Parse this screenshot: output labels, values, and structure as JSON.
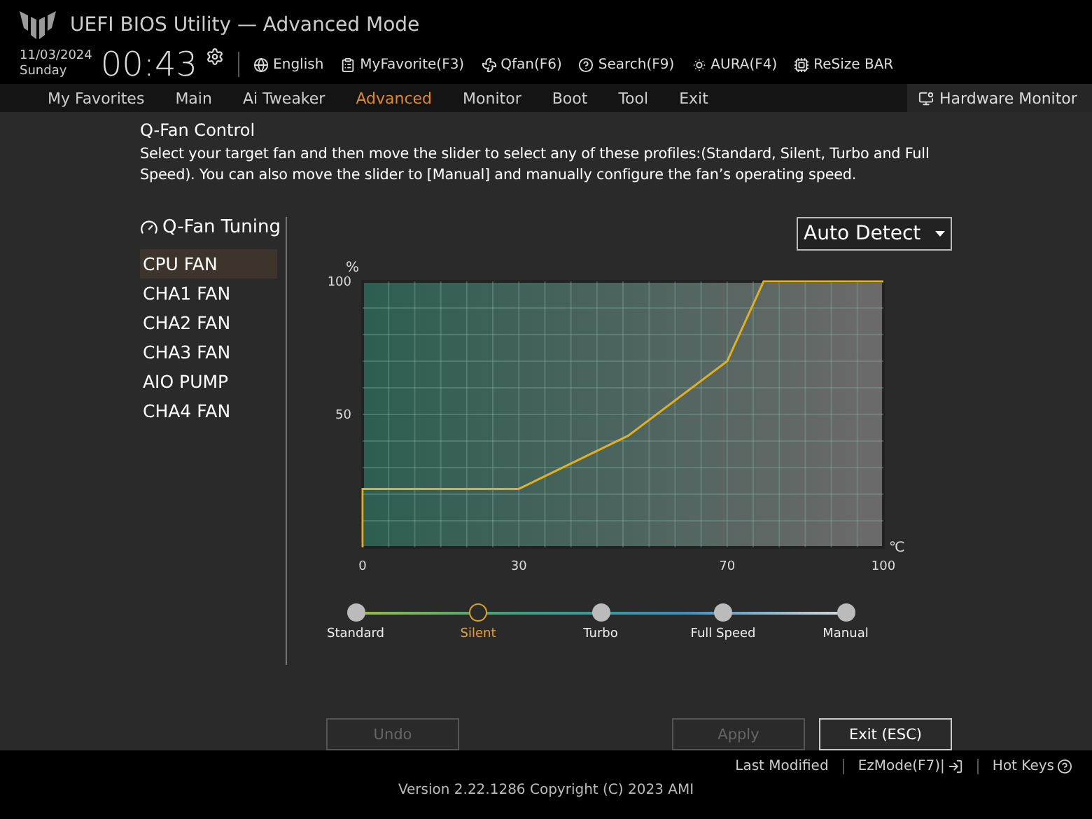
{
  "header": {
    "title": "UEFI BIOS Utility — Advanced Mode",
    "date": "11/03/2024",
    "day": "Sunday",
    "time": "00:43",
    "toolbar": [
      {
        "label": "English",
        "kind": "globe"
      },
      {
        "label": "MyFavorite(F3)",
        "kind": "list"
      },
      {
        "label": "Qfan(F6)",
        "kind": "fan"
      },
      {
        "label": "Search(F9)",
        "kind": "help"
      },
      {
        "label": "AURA(F4)",
        "kind": "light"
      },
      {
        "label": "ReSize BAR",
        "kind": "chip"
      }
    ]
  },
  "tabs": [
    {
      "label": "My Favorites",
      "selected": false
    },
    {
      "label": "Main",
      "selected": false
    },
    {
      "label": "Ai Tweaker",
      "selected": false
    },
    {
      "label": "Advanced",
      "selected": true
    },
    {
      "label": "Monitor",
      "selected": false
    },
    {
      "label": "Boot",
      "selected": false
    },
    {
      "label": "Tool",
      "selected": false
    },
    {
      "label": "Exit",
      "selected": false
    }
  ],
  "hardware_monitor": "Hardware Monitor",
  "dialog": {
    "title": "Q-Fan Control",
    "description": "Select your target fan and then move the slider to select any of these profiles:(Standard, Silent, Turbo and Full Speed). You can also move the slider to [Manual] and manually configure the fan’s operating speed.",
    "section": "Q-Fan Tuning",
    "fans": [
      {
        "label": "CPU FAN",
        "selected": true
      },
      {
        "label": "CHA1 FAN",
        "selected": false
      },
      {
        "label": "CHA2 FAN",
        "selected": false
      },
      {
        "label": "CHA3 FAN",
        "selected": false
      },
      {
        "label": "AIO PUMP",
        "selected": false
      },
      {
        "label": "CHA4 FAN",
        "selected": false
      }
    ],
    "mode": "Auto Detect",
    "chart_data": {
      "type": "line",
      "xlabel": "℃",
      "ylabel": "%",
      "x": [
        0,
        0,
        30,
        51,
        70,
        77,
        100
      ],
      "series": [
        {
          "color": "#e0b020",
          "values": [
            0,
            22,
            22,
            42,
            70,
            100,
            100
          ]
        }
      ],
      "xlim": [
        0,
        100
      ],
      "ylim": [
        0,
        100
      ],
      "grid": true,
      "xticks": [
        0,
        30,
        70,
        100
      ],
      "yticks": [
        50,
        100
      ]
    },
    "profiles": [
      {
        "label": "Standard",
        "selected": false
      },
      {
        "label": "Silent",
        "selected": true
      },
      {
        "label": "Turbo",
        "selected": false
      },
      {
        "label": "Full Speed",
        "selected": false
      },
      {
        "label": "Manual",
        "selected": false
      }
    ],
    "buttons": [
      {
        "label": "Undo",
        "disabled": true
      },
      {
        "label": "Apply",
        "disabled": true
      },
      {
        "label": "Exit (ESC)",
        "disabled": false
      }
    ]
  },
  "footer": {
    "version": "Version 2.22.1286 Copyright (C) 2023 AMI",
    "links": [
      {
        "label": "Last Modified"
      },
      {
        "label": "EzMode(F7)|",
        "kind": "enter"
      },
      {
        "label": "Hot Keys",
        "kind": "help"
      }
    ]
  }
}
